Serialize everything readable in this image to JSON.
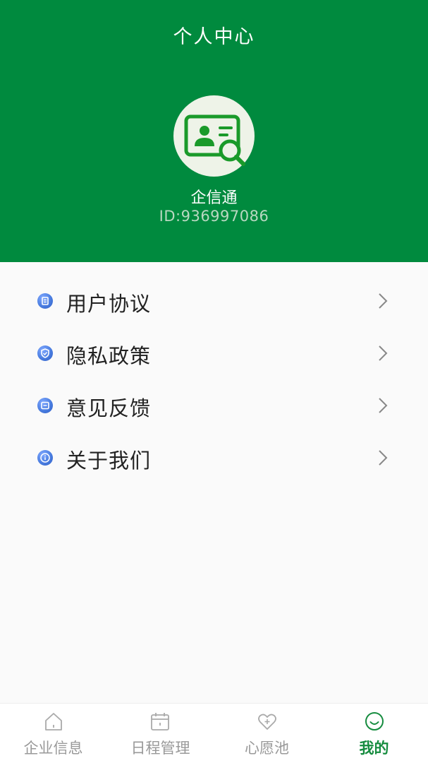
{
  "header": {
    "title": "个人中心",
    "user_name": "企信通",
    "user_id": "ID:936997086"
  },
  "menu": {
    "items": [
      {
        "label": "用户协议",
        "icon": "document-icon"
      },
      {
        "label": "隐私政策",
        "icon": "shield-icon"
      },
      {
        "label": "意见反馈",
        "icon": "feedback-icon"
      },
      {
        "label": "关于我们",
        "icon": "info-icon"
      }
    ]
  },
  "tabbar": {
    "tabs": [
      {
        "label": "企业信息",
        "icon": "home-icon",
        "active": false
      },
      {
        "label": "日程管理",
        "icon": "calendar-icon",
        "active": false
      },
      {
        "label": "心愿池",
        "icon": "heart-plus-icon",
        "active": false
      },
      {
        "label": "我的",
        "icon": "smile-icon",
        "active": true
      }
    ]
  },
  "colors": {
    "header_bg": "#008a3e",
    "accent": "#168c3f",
    "menu_icon": "#4a7de0",
    "inactive_tab": "#999999"
  }
}
